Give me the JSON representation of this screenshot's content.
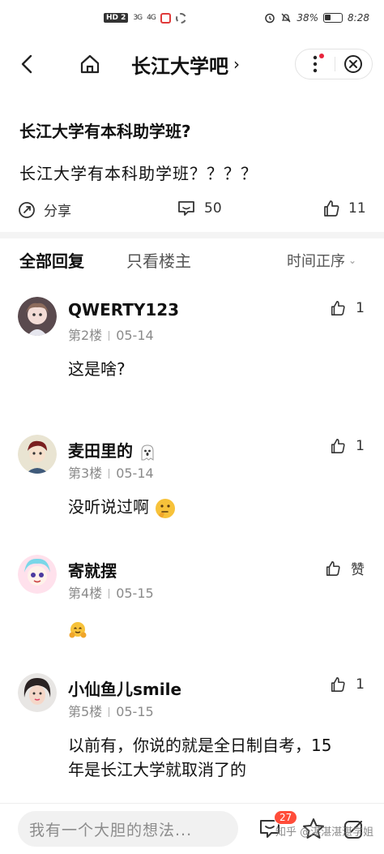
{
  "status_bar": {
    "left_badge": "HD 2",
    "signal_1": "3G",
    "signal_2": "4G",
    "battery": "38%",
    "time": "8:28"
  },
  "nav": {
    "title": "长江大学吧",
    "title_chevron": "›"
  },
  "post": {
    "title": "长江大学有本科助学班?",
    "body": "长江大学有本科助学班？？？？",
    "share_label": "分享",
    "comment_count": "50",
    "like_count": "11"
  },
  "tabs": {
    "all_replies": "全部回复",
    "only_op": "只看楼主",
    "sort_label": "时间正序"
  },
  "replies": [
    {
      "name": "QWERTY123",
      "floor": "第2楼",
      "date": "05-14",
      "likes": "1",
      "text": "这是啥?"
    },
    {
      "name": "麦田里的",
      "floor": "第3楼",
      "date": "05-14",
      "likes": "1",
      "text": "没听说过啊"
    },
    {
      "name": "寄就摆",
      "floor": "第4楼",
      "date": "05-15",
      "likes": "赞",
      "text": ""
    },
    {
      "name": "小仙鱼儿smile",
      "floor": "第5楼",
      "date": "05-15",
      "likes": "1",
      "text": "以前有，你说的就是全日制自考，15年是长江大学就取消了的"
    }
  ],
  "bottom_bar": {
    "input_placeholder": "我有一个大胆的想法...",
    "comment_badge": "27",
    "watermark": "知乎 @湛湛湛湛学姐"
  },
  "colors": {
    "accent_red": "#e8243c",
    "badge_red": "#ff4d3a",
    "muted_text": "#8a8a8a"
  }
}
